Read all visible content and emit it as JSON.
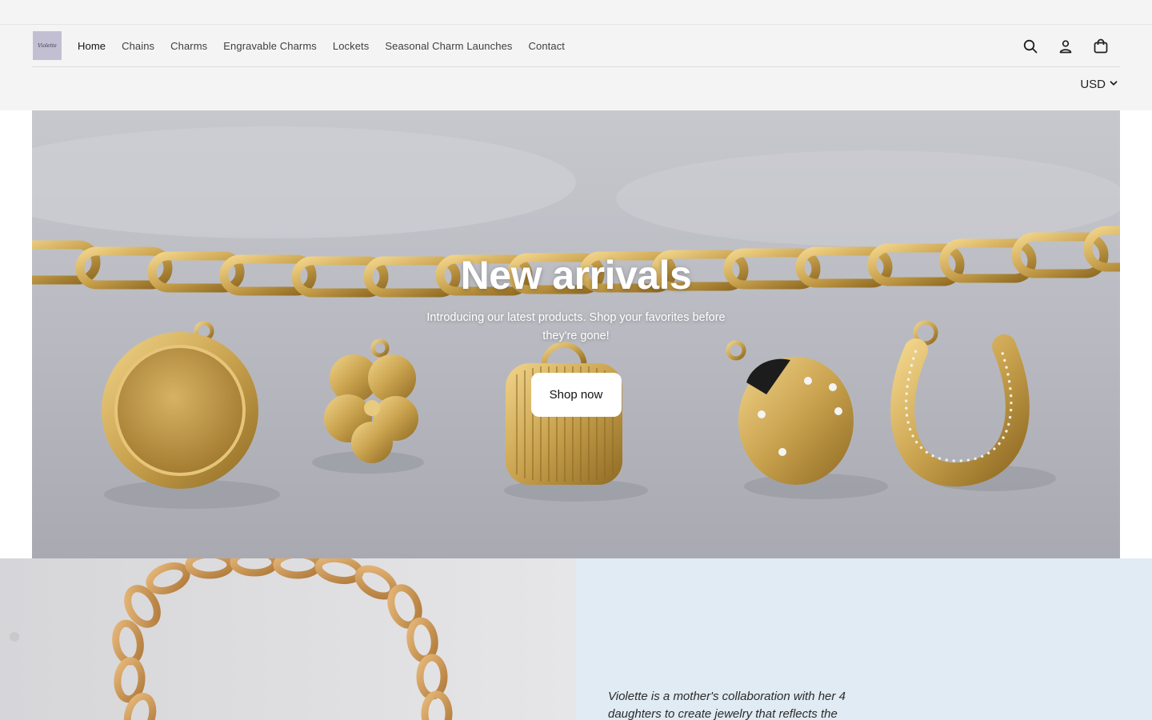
{
  "header": {
    "logo_text": "Violette",
    "nav": [
      {
        "label": "Home",
        "active": true
      },
      {
        "label": "Chains"
      },
      {
        "label": "Charms"
      },
      {
        "label": "Engravable Charms"
      },
      {
        "label": "Lockets"
      },
      {
        "label": "Seasonal Charm Launches"
      },
      {
        "label": "Contact"
      }
    ],
    "icons": [
      "search-icon",
      "account-icon",
      "cart-icon"
    ],
    "currency": "USD"
  },
  "hero": {
    "title": "New arrivals",
    "text": "Introducing our latest products. Shop your favorites before they're gone!",
    "button_label": "Shop now"
  },
  "feature": {
    "text": "Violette is a mother's collaboration with her 4 daughters to create jewelry that reflects the"
  },
  "colors": {
    "header_bg": "#f4f4f4",
    "feature_bg": "#e1ebf3",
    "gold": "#c9a24e"
  }
}
